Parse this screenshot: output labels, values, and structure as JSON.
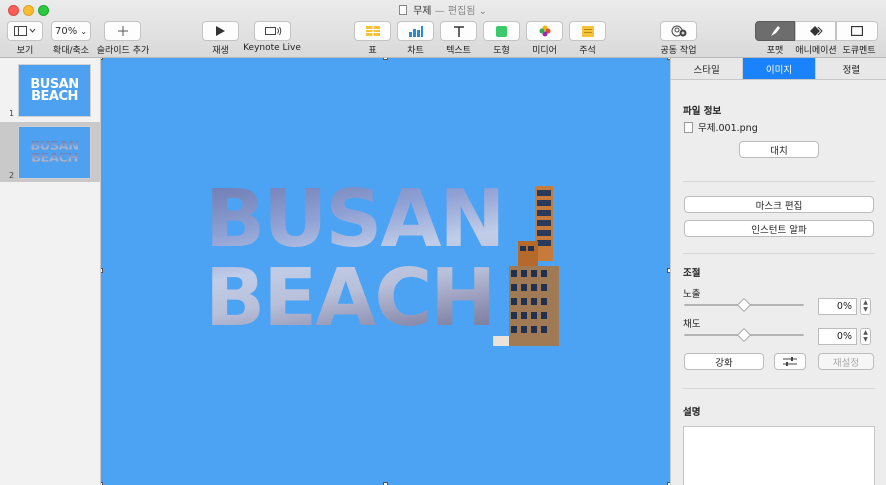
{
  "window": {
    "title": "무제",
    "subtitle": "— 편집됨",
    "close_color": "#fc5f57",
    "minimize_color": "#fdbc2e",
    "zoom_color": "#2bc840"
  },
  "toolbar": {
    "view_label": "보기",
    "zoom_value": "70%",
    "zoom_label": "확대/축소",
    "add_slide_label": "슬라이드 추가",
    "play_label": "재생",
    "keynote_live_label": "Keynote Live",
    "table_label": "표",
    "chart_label": "차트",
    "text_label": "텍스트",
    "shape_label": "도형",
    "media_label": "미디어",
    "comment_label": "주석",
    "collaborate_label": "공동 작업",
    "format_label": "포맷",
    "animate_label": "애니메이션",
    "document_label": "도큐멘트"
  },
  "navigator": {
    "slides": [
      {
        "number": "1",
        "line1": "BUSAN",
        "line2": "BEACH"
      },
      {
        "number": "2",
        "line1": "BUSAN",
        "line2": "BEACH"
      }
    ],
    "selected_index": 1
  },
  "canvas": {
    "background": "#4da3f3",
    "line1": "BUSAN",
    "line2": "BEACH"
  },
  "inspector": {
    "tabs": [
      "스타일",
      "이미지",
      "정렬"
    ],
    "active_tab": "이미지",
    "accent": "#1a82fb",
    "file_info_title": "파일 정보",
    "file_name": "무제.001.png",
    "replace_button": "대치",
    "edit_mask_button": "마스크 편집",
    "instant_alpha_button": "인스턴트 알파",
    "adjust_title": "조절",
    "exposure_label": "노출",
    "exposure_value": "0%",
    "exposure_level": 0.5,
    "saturation_label": "채도",
    "saturation_value": "0%",
    "saturation_level": 0.5,
    "enhance_button": "강화",
    "reset_button": "재설정",
    "description_title": "설명"
  }
}
